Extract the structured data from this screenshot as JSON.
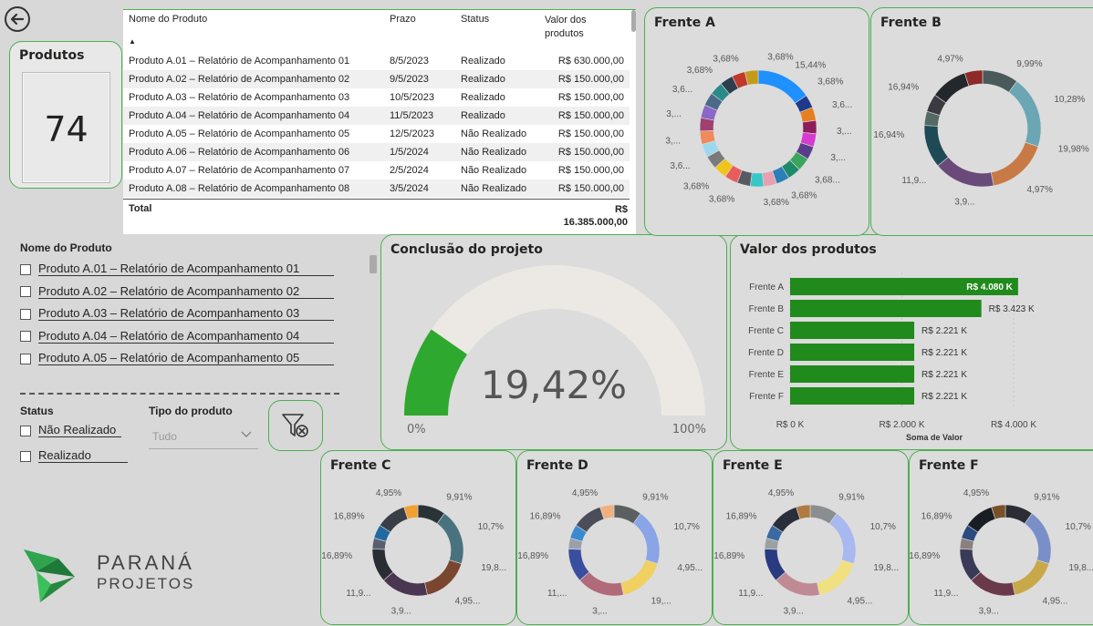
{
  "back_button": {
    "icon": "arrow-left-circle-icon"
  },
  "produtos_card": {
    "title": "Produtos",
    "value": "74"
  },
  "table": {
    "headers": {
      "name": "Nome do Produto",
      "deadline": "Prazo",
      "status": "Status",
      "value": "Valor dos produtos"
    },
    "rows": [
      {
        "name": "Produto A.01 – Relatório de Acompanhamento 01",
        "deadline": "8/5/2023",
        "status": "Realizado",
        "value": "R$ 630.000,00"
      },
      {
        "name": "Produto A.02 – Relatório de Acompanhamento 02",
        "deadline": "9/5/2023",
        "status": "Realizado",
        "value": "R$ 150.000,00"
      },
      {
        "name": "Produto A.03 – Relatório de Acompanhamento 03",
        "deadline": "10/5/2023",
        "status": "Realizado",
        "value": "R$ 150.000,00"
      },
      {
        "name": "Produto A.04 – Relatório de Acompanhamento 04",
        "deadline": "11/5/2023",
        "status": "Realizado",
        "value": "R$ 150.000,00"
      },
      {
        "name": "Produto A.05 – Relatório de Acompanhamento 05",
        "deadline": "12/5/2023",
        "status": "Não Realizado",
        "value": "R$ 150.000,00"
      },
      {
        "name": "Produto A.06 – Relatório de Acompanhamento 06",
        "deadline": "1/5/2024",
        "status": "Não Realizado",
        "value": "R$ 150.000,00"
      },
      {
        "name": "Produto A.07 – Relatório de Acompanhamento 07",
        "deadline": "2/5/2024",
        "status": "Não Realizado",
        "value": "R$ 150.000,00"
      },
      {
        "name": "Produto A.08 – Relatório de Acompanhamento 08",
        "deadline": "3/5/2024",
        "status": "Não Realizado",
        "value": "R$ 150.000,00"
      }
    ],
    "total_label": "Total",
    "total_value_line1": "R$",
    "total_value_line2": "16.385.000,00"
  },
  "slicer_produto": {
    "title": "Nome do Produto",
    "items": [
      "Produto A.01 – Relatório de Acompanhamento 01",
      "Produto A.02 – Relatório de Acompanhamento 02",
      "Produto A.03 – Relatório de Acompanhamento 03",
      "Produto A.04 – Relatório de Acompanhamento 04",
      "Produto A.05 – Relatório de Acompanhamento 05"
    ]
  },
  "slicer_status": {
    "title": "Status",
    "items": [
      "Não Realizado",
      "Realizado"
    ]
  },
  "slicer_tipo": {
    "title": "Tipo do produto",
    "selected": "Tudo"
  },
  "clear_filter": {
    "icon": "clear-filter-icon"
  },
  "logo": {
    "line1": "PARANÁ",
    "line2": "PROJETOS"
  },
  "gauge": {
    "title": "Conclusão do projeto",
    "value_label": "19,42%",
    "value": 19.42,
    "min_label": "0%",
    "max_label": "100%",
    "fill_color": "#2ea82e",
    "track_color": "#ece9e4"
  },
  "bar_chart": {
    "title": "Valor dos produtos"
  },
  "donuts": [
    {
      "title": "Frente A",
      "labels": [
        "3,68%",
        "3,68%",
        "15,44%",
        "3,68%",
        "3,6...",
        "3,...",
        "3,...",
        "3,68...",
        "3,68%",
        "3,68%",
        "3,68%",
        "3,68%",
        "3,6...",
        "3,...",
        "3,...",
        "3,6...",
        "3,68%"
      ]
    },
    {
      "title": "Frente B",
      "labels": [
        "4,97%",
        "9,99%",
        "10,28%",
        "19,98%",
        "4,97%",
        "3,9...",
        "11,9...",
        "16,94%",
        "16,94%"
      ]
    },
    {
      "title": "Frente C",
      "labels": [
        "4,95%",
        "9,91%",
        "10,7%",
        "19,8...",
        "4,95...",
        "3,9...",
        "11,9...",
        "16,89%",
        "16,89%"
      ]
    },
    {
      "title": "Frente D",
      "labels": [
        "4,95%",
        "9,91%",
        "10,7%",
        "4,95...",
        "19,...",
        "3,...",
        "11,...",
        "16,89%",
        "16,89%"
      ]
    },
    {
      "title": "Frente E",
      "labels": [
        "4,95%",
        "9,91%",
        "10,7%",
        "19,8...",
        "4,95...",
        "3,9...",
        "11,9...",
        "16,89%",
        "16,89%"
      ]
    },
    {
      "title": "Frente F",
      "labels": [
        "4,95%",
        "9,91%",
        "10,7%",
        "19,8...",
        "4,95...",
        "3,9...",
        "11,9...",
        "16,89%",
        "16,89%"
      ]
    }
  ],
  "chart_data": [
    {
      "type": "bar",
      "title": "Valor dos produtos",
      "categories": [
        "Frente A",
        "Frente B",
        "Frente C",
        "Frente D",
        "Frente E",
        "Frente F"
      ],
      "values": [
        4080,
        3423,
        2221,
        2221,
        2221,
        2221
      ],
      "value_labels": [
        "R$ 4.080 K",
        "R$ 3.423 K",
        "R$ 2.221 K",
        "R$ 2.221 K",
        "R$ 2.221 K",
        "R$ 2.221 K"
      ],
      "xlabel": "Soma de Valor",
      "xticks": [
        "R$ 0 K",
        "R$ 2.000 K",
        "R$ 4.000 K"
      ],
      "xlim": [
        0,
        4500
      ],
      "color": "#218a1c"
    },
    {
      "type": "pie",
      "title": "Frente A",
      "values": [
        15.44,
        3.68,
        3.68,
        3.68,
        3.68,
        3.68,
        3.68,
        3.68,
        3.68,
        3.68,
        3.68,
        3.68,
        3.68,
        3.68,
        3.68,
        3.68,
        3.68,
        3.68,
        3.68,
        3.68,
        3.68,
        3.68,
        3.68,
        3.68
      ],
      "colors": [
        "#1e90ff",
        "#1f3a8a",
        "#e67e22",
        "#8e1d5b",
        "#d63ad0",
        "#5a3d8a",
        "#3ba55d",
        "#1d8a6a",
        "#2a7fb8",
        "#e6a0b0",
        "#38c7c7",
        "#555a63",
        "#e85c5c",
        "#f0c419",
        "#7a7a7a",
        "#9ed8ee",
        "#ef8a5a",
        "#a04070",
        "#8a67c8",
        "#4a6a8a",
        "#2a8a8a",
        "#2e3e4e",
        "#c0392b",
        "#c49a1a"
      ]
    },
    {
      "type": "pie",
      "title": "Frente B",
      "values": [
        9.99,
        19.98,
        16.94,
        16.94,
        11.9,
        3.9,
        4.97,
        10.28,
        4.97
      ],
      "colors": [
        "#4a5a5a",
        "#6aa6b4",
        "#c87a46",
        "#6a4a7a",
        "#1e4a55",
        "#556a64",
        "#3a3a40",
        "#24282c",
        "#8e2a2a"
      ]
    },
    {
      "type": "pie",
      "title": "Frente C",
      "values": [
        9.91,
        19.8,
        16.89,
        16.89,
        11.9,
        3.9,
        4.95,
        10.7,
        4.95
      ],
      "colors": [
        "#2a3438",
        "#48737e",
        "#7a4630",
        "#4a3650",
        "#2a2e34",
        "#5a5f70",
        "#1f6aa0",
        "#3a3e46",
        "#f0a030"
      ]
    },
    {
      "type": "pie",
      "title": "Frente D",
      "values": [
        9.91,
        19.8,
        16.89,
        16.89,
        11.9,
        3.9,
        4.95,
        10.7,
        4.95
      ],
      "colors": [
        "#5a6060",
        "#8aa4e8",
        "#f0d060",
        "#b06a7a",
        "#3a4ea0",
        "#9aa0aa",
        "#3a8ad0",
        "#4a4e58",
        "#f0b080"
      ]
    },
    {
      "type": "pie",
      "title": "Frente E",
      "values": [
        9.91,
        19.8,
        16.89,
        16.89,
        11.9,
        3.9,
        4.95,
        10.7,
        4.95
      ],
      "colors": [
        "#8a8e90",
        "#a8b8f0",
        "#f0e080",
        "#c08a94",
        "#2a3a80",
        "#9aa0a4",
        "#3a6aa0",
        "#2a2e3a",
        "#b07a40"
      ]
    },
    {
      "type": "pie",
      "title": "Frente F",
      "values": [
        9.91,
        19.8,
        16.89,
        16.89,
        11.9,
        3.9,
        4.95,
        10.7,
        4.95
      ],
      "colors": [
        "#2a2e34",
        "#7a8ec8",
        "#c8a848",
        "#6a3a4a",
        "#3a3a58",
        "#8a8080",
        "#2a4a80",
        "#1a1e24",
        "#7a5028"
      ]
    }
  ]
}
